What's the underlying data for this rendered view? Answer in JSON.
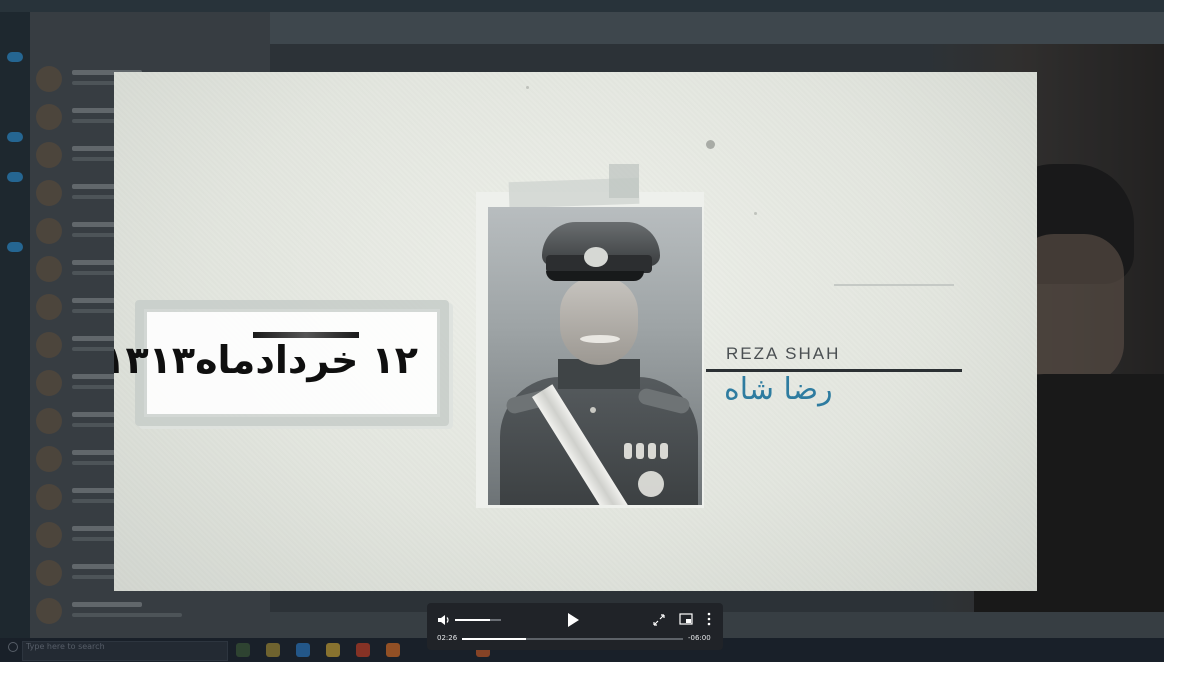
{
  "player": {
    "time_current": "02:26",
    "time_remaining": "-06:00",
    "progress_fraction": 0.29,
    "volume_fraction": 0.75,
    "play_label": "Play"
  },
  "video_frame": {
    "date_text": "۱۲ خردادماه۱۳۱۳",
    "name_english": "REZA SHAH",
    "name_persian": "رضا شاه",
    "name_color": "#2e7ca0"
  },
  "background_app": {
    "taskbar_search_placeholder": "Type here to search"
  }
}
